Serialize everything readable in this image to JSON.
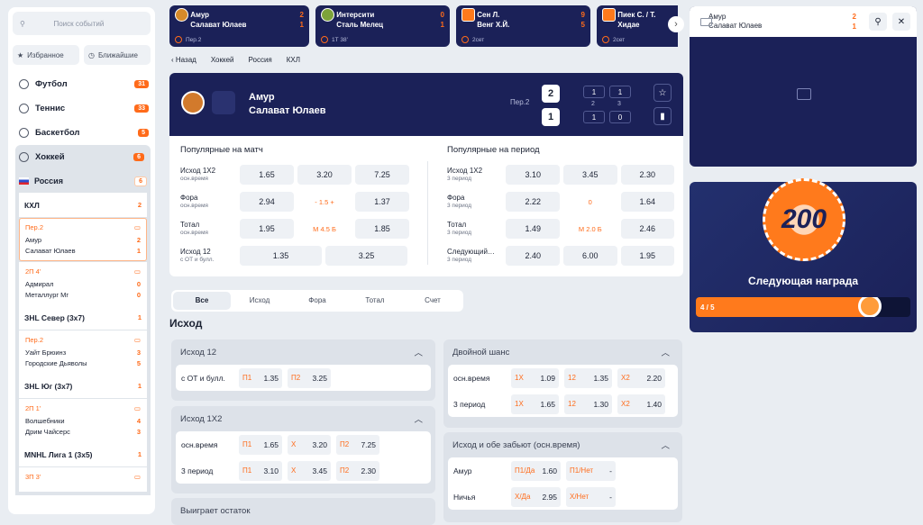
{
  "left": {
    "search_placeholder": "Поиск событий",
    "fav": "Избранное",
    "near": "Ближайшие",
    "sports": [
      {
        "name": "Футбол",
        "count": "31"
      },
      {
        "name": "Теннис",
        "count": "33"
      },
      {
        "name": "Баскетбол",
        "count": "5"
      },
      {
        "name": "Хоккей",
        "count": "6"
      }
    ],
    "country": {
      "name": "Россия",
      "count": "6"
    },
    "leagues": [
      {
        "name": "КХЛ",
        "count": "2",
        "matches": [
          {
            "status": "Пер.2",
            "t1": "Амур",
            "s1": "2",
            "t2": "Салават Юлаев",
            "s2": "1"
          },
          {
            "status": "2П 4'",
            "t1": "Адмирал",
            "s1": "0",
            "t2": "Металлург Мг",
            "s2": "0"
          }
        ]
      },
      {
        "name": "ЗНL Север (3х7)",
        "count": "1",
        "matches": [
          {
            "status": "Пер.2",
            "t1": "Уайт Брюинз",
            "s1": "3",
            "t2": "Городские Дьяволы",
            "s2": "5"
          }
        ]
      },
      {
        "name": "ЗНL Юг (3х7)",
        "count": "1",
        "matches": [
          {
            "status": "2П 1'",
            "t1": "Волшебники",
            "s1": "4",
            "t2": "Дрим Чайсерс",
            "s2": "3"
          }
        ]
      },
      {
        "name": "MNHL Лига 1 (3х5)",
        "count": "1",
        "matches": [
          {
            "status": "3П 3'",
            "t1": "",
            "s1": "",
            "t2": "",
            "s2": ""
          }
        ]
      }
    ]
  },
  "top": [
    {
      "t1": "Амур",
      "s1": "2",
      "t2": "Салават Юлаев",
      "s2": "1",
      "meta": "Пер.2"
    },
    {
      "t1": "Интерсити",
      "s1": "0",
      "t2": "Сталь Мелец",
      "s2": "1",
      "meta": "1Т 38'"
    },
    {
      "t1": "Сен Л.",
      "s1": "9",
      "t2": "Венг Х.Й.",
      "s2": "5",
      "meta": "2сет"
    },
    {
      "t1": "Пиек С. / Т.",
      "s1": "",
      "t2": "Хидае",
      "s2": "",
      "meta": "2сет"
    }
  ],
  "crumbs": {
    "back": "Назад",
    "c1": "Хоккей",
    "c2": "Россия",
    "c3": "КХЛ"
  },
  "hero": {
    "t1": "Амур",
    "t2": "Салават Юлаев",
    "period": "Пер.2",
    "s1": "2",
    "s2": "1",
    "p1a": "1",
    "p1b": "1",
    "p2a": "1",
    "p2b": "0",
    "pn1": "2",
    "pn2": "3"
  },
  "popular": {
    "match_title": "Популярные на матч",
    "period_title": "Популярные на период",
    "match": [
      {
        "l": "Исход 1Х2",
        "s": "осн.время",
        "v": [
          "1.65",
          "3.20",
          "7.25"
        ]
      },
      {
        "l": "Фора",
        "s": "осн.время",
        "v": [
          "2.94",
          "- 1.5 +",
          "1.37"
        ]
      },
      {
        "l": "Тотал",
        "s": "осн.время",
        "v": [
          "1.95",
          "М 4.5 Б",
          "1.85"
        ]
      },
      {
        "l": "Исход 12",
        "s": "с ОТ и булл.",
        "v": [
          "1.35",
          "3.25"
        ]
      }
    ],
    "period": [
      {
        "l": "Исход 1Х2",
        "s": "3 период",
        "v": [
          "3.10",
          "3.45",
          "2.30"
        ]
      },
      {
        "l": "Фора",
        "s": "3 период",
        "v": [
          "2.22",
          "0",
          "1.64"
        ]
      },
      {
        "l": "Тотал",
        "s": "3 период",
        "v": [
          "1.49",
          "М 2.0 Б",
          "2.46"
        ]
      },
      {
        "l": "Следующий…",
        "s": "3 период",
        "v": [
          "2.40",
          "6.00",
          "1.95"
        ]
      }
    ]
  },
  "tabs": [
    "Все",
    "Исход",
    "Фора",
    "Тотал",
    "Счет"
  ],
  "section": "Исход",
  "markets": {
    "m1": {
      "title": "Исход 12",
      "row": {
        "l": "с ОТ и булл.",
        "o": [
          [
            "П1",
            "1.35"
          ],
          [
            "П2",
            "3.25"
          ]
        ]
      }
    },
    "m2": {
      "title": "Исход 1Х2",
      "rows": [
        {
          "l": "осн.время",
          "o": [
            [
              "П1",
              "1.65"
            ],
            [
              "Х",
              "3.20"
            ],
            [
              "П2",
              "7.25"
            ]
          ]
        },
        {
          "l": "3 период",
          "o": [
            [
              "П1",
              "3.10"
            ],
            [
              "Х",
              "3.45"
            ],
            [
              "П2",
              "2.30"
            ]
          ]
        }
      ]
    },
    "m3": {
      "title": "Выиграет остаток"
    },
    "m4": {
      "title": "Двойной шанс",
      "rows": [
        {
          "l": "осн.время",
          "o": [
            [
              "1Х",
              "1.09"
            ],
            [
              "12",
              "1.35"
            ],
            [
              "Х2",
              "2.20"
            ]
          ]
        },
        {
          "l": "3 период",
          "o": [
            [
              "1Х",
              "1.65"
            ],
            [
              "12",
              "1.30"
            ],
            [
              "Х2",
              "1.40"
            ]
          ]
        }
      ]
    },
    "m5": {
      "title": "Исход и обе забьют (осн.время)",
      "rows": [
        {
          "l": "Амур",
          "o": [
            [
              "П1/Да",
              "1.60"
            ],
            [
              "П1/Нет",
              "-"
            ]
          ]
        },
        {
          "l": "Ничья",
          "o": [
            [
              "Х/Да",
              "2.95"
            ],
            [
              "Х/Нет",
              "-"
            ]
          ]
        }
      ]
    }
  },
  "widget": {
    "t1": "Амур",
    "t2": "Салават Юлаев",
    "s1": "2",
    "s2": "1"
  },
  "reward": {
    "chip": "200",
    "title": "Следующая награда",
    "progress": "4 / 5",
    "ratio": 0.8
  }
}
